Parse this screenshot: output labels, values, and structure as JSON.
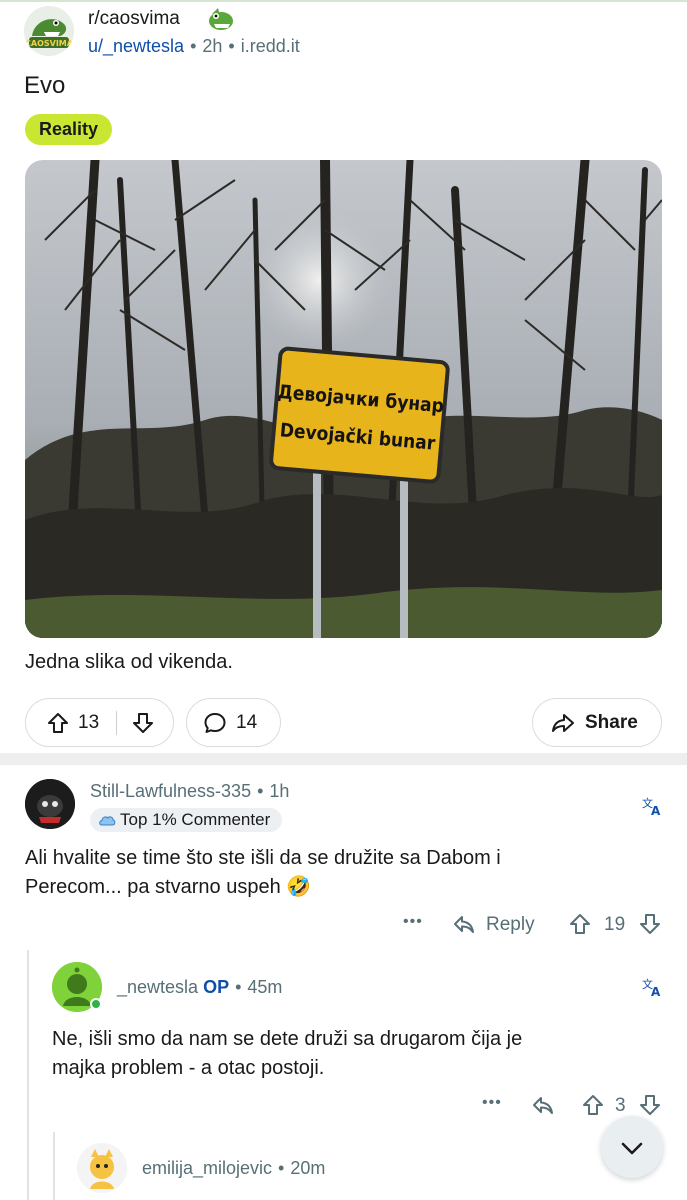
{
  "post": {
    "subreddit": "r/caosvima",
    "author": "u/_newtesla",
    "age": "2h",
    "domain": "i.redd.it",
    "title": "Evo",
    "flair": "Reality",
    "image_sign_cyrillic": "Девојачки бунар",
    "image_sign_latin": "Devojački bunar",
    "body": "Jedna slika od vikenda.",
    "upvotes": "13",
    "comments": "14",
    "share_label": "Share"
  },
  "comments": [
    {
      "author": "Still-Lawfulness-335",
      "age": "1h",
      "badge": "Top 1% Commenter",
      "text_line1": "Ali hvalite se time što ste išli da se družite sa Dabom i",
      "text_line2": "Perecom... pa stvarno uspeh 🤣",
      "reply_label": "Reply",
      "score": "19",
      "more": "•••"
    },
    {
      "author": "_newtesla",
      "op_label": "OP",
      "age": "45m",
      "text_line1": "Ne, išli smo da nam se dete druži sa drugarom čija je",
      "text_line2": "majka problem - a otac postoji.",
      "score": "3",
      "more": "•••"
    },
    {
      "author": "emilija_milojevic",
      "age": "20m"
    }
  ],
  "colors": {
    "accent_blue": "#0f4fa8",
    "flair_green": "#c9e633",
    "meta_gray": "#576f76"
  },
  "icons": {
    "upvote": "arrow-up-icon",
    "downvote": "arrow-down-icon",
    "comment": "speech-bubble-icon",
    "share": "share-arrow-icon",
    "reply": "reply-arrow-icon",
    "translate": "translate-icon",
    "scroll": "chevron-down-icon"
  }
}
